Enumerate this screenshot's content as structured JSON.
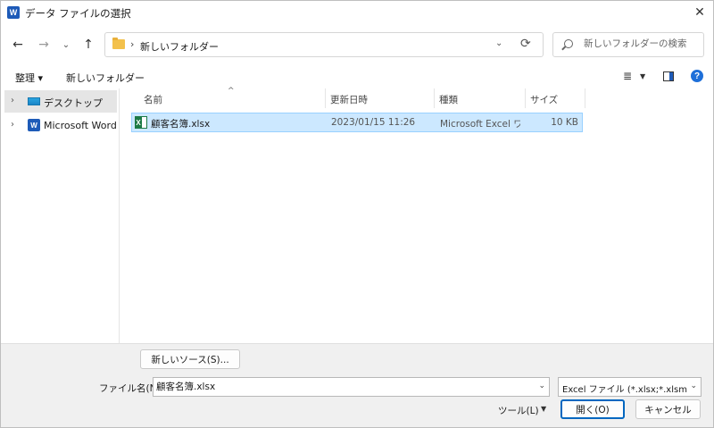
{
  "titlebar": {
    "app_icon": "W",
    "title": "データ ファイルの選択",
    "close": "✕"
  },
  "nav": {
    "back": "←",
    "forward": "→",
    "recent": "⌄",
    "up": "↑",
    "breadcrumb_sep": "›",
    "breadcrumb": "新しいフォルダー",
    "dropdown": "⌄",
    "refresh": "⟳",
    "search_placeholder": "新しいフォルダーの検索"
  },
  "toolbar": {
    "organize": "整理 ▾",
    "new_folder": "新しいフォルダー",
    "view_icon": "≣",
    "view_caret": "▼",
    "help": "?"
  },
  "sidebar": {
    "items": [
      {
        "label": "デスクトップ",
        "icon": "desktop-icon",
        "selected": true
      },
      {
        "label": "Microsoft Word",
        "icon": "word-icon",
        "selected": false
      }
    ]
  },
  "filelist": {
    "columns": [
      "名前",
      "更新日時",
      "種類",
      "サイズ"
    ],
    "sort_indicator": "^",
    "rows": [
      {
        "name": "顧客名簿.xlsx",
        "modified": "2023/01/15 11:26",
        "type": "Microsoft Excel ワ...",
        "size": "10 KB",
        "selected": true
      }
    ]
  },
  "bottom": {
    "new_source_button": "新しいソース(S)...",
    "file_name_label": "ファイル名(N):",
    "file_name_value": "顧客名簿.xlsx",
    "file_type": "Excel ファイル (*.xlsx;*.xlsm;*.xlsb",
    "tools": "ツール(L)",
    "open_button": "開く(O)",
    "cancel_button": "キャンセル"
  },
  "colors": {
    "selection": "#cce8ff",
    "accent": "#0067c0"
  }
}
